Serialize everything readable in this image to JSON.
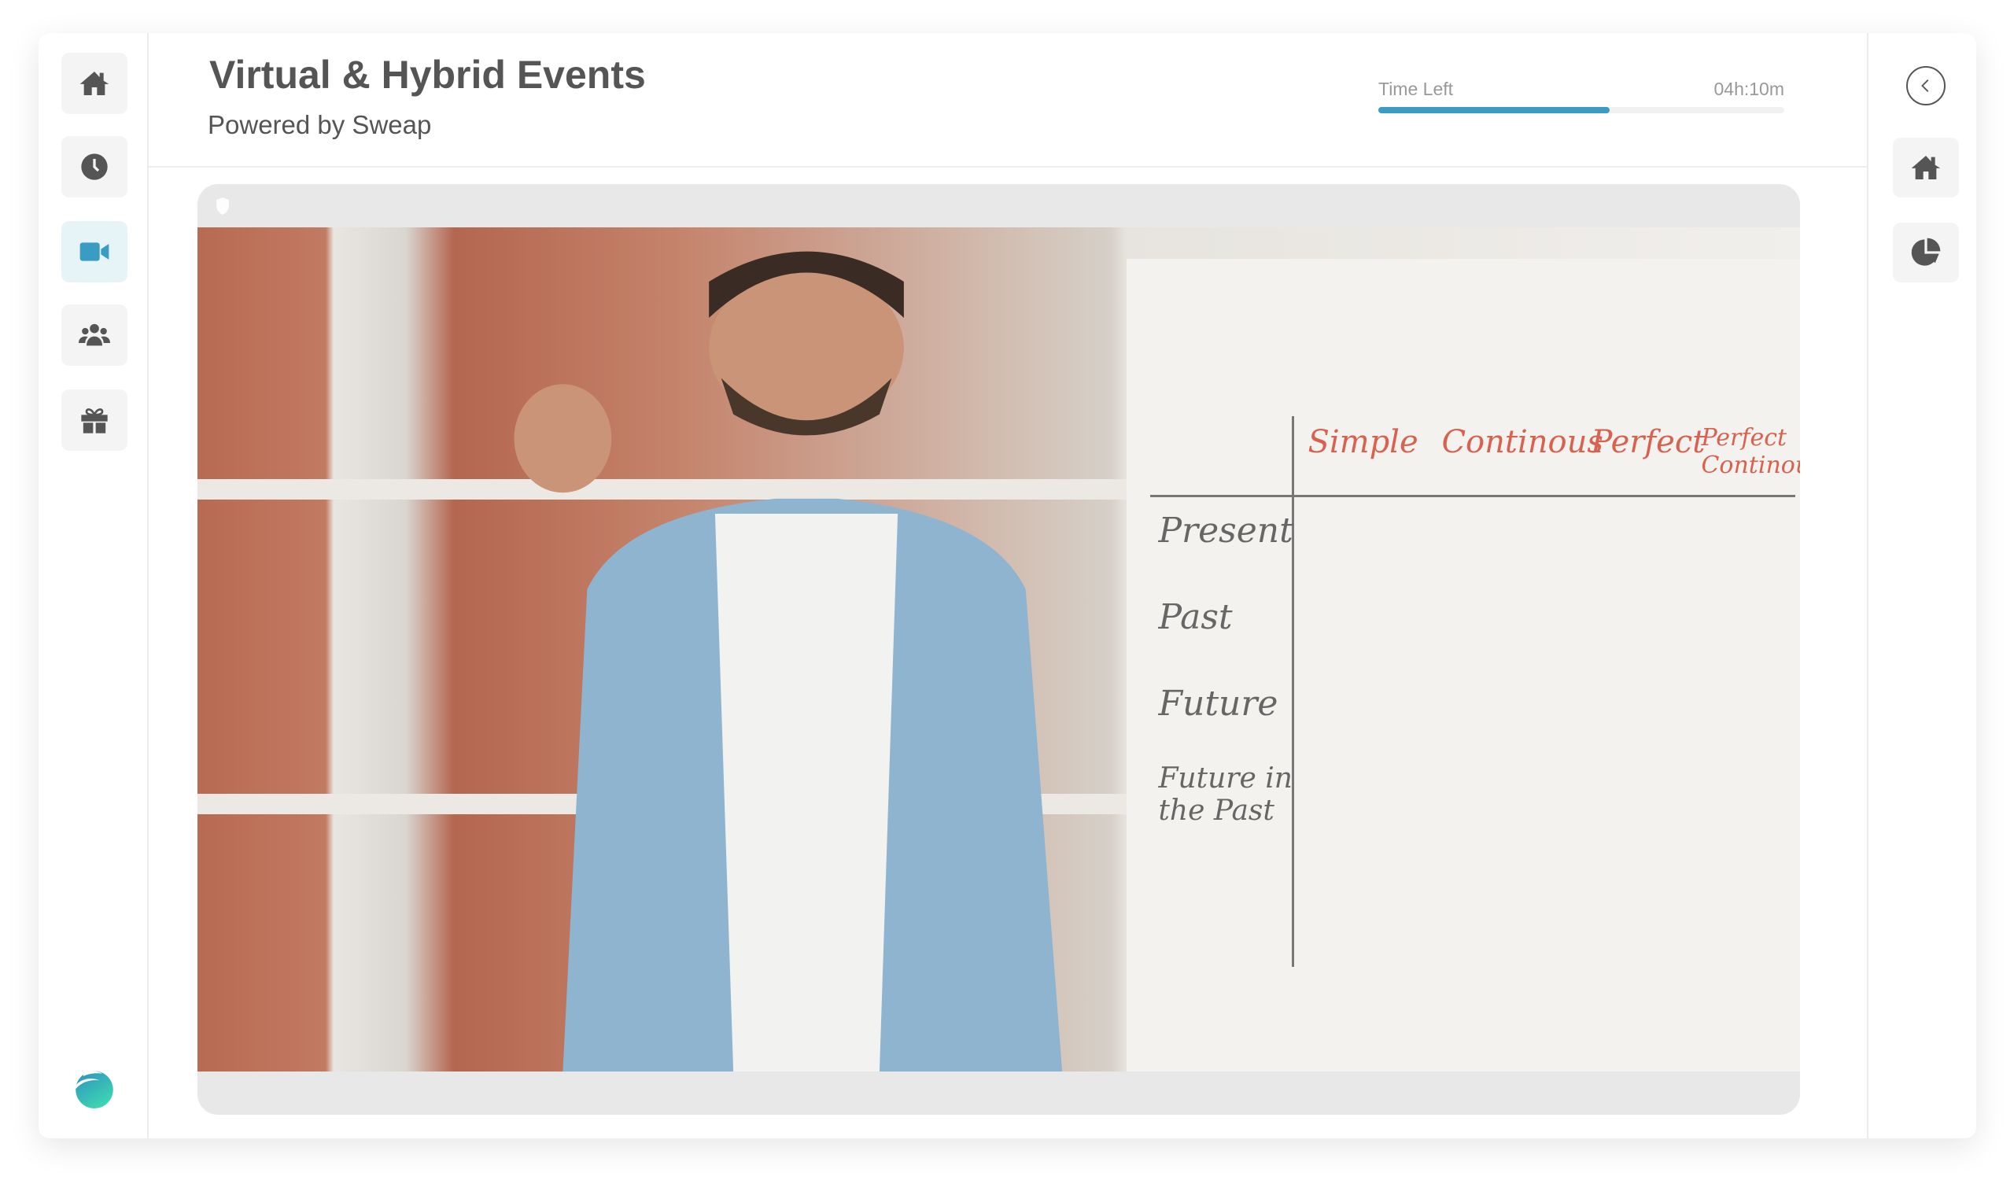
{
  "header": {
    "title": "Virtual & Hybrid Events",
    "subtitle": "Powered by Sweap"
  },
  "timer": {
    "label": "Time Left",
    "value": "04h:10m",
    "progress_fraction": 0.57
  },
  "sidebar": {
    "items": [
      {
        "icon": "home-icon",
        "active": false
      },
      {
        "icon": "clock-icon",
        "active": false
      },
      {
        "icon": "video-camera-icon",
        "active": true
      },
      {
        "icon": "users-icon",
        "active": false
      },
      {
        "icon": "gift-icon",
        "active": false
      }
    ]
  },
  "right_sidebar": {
    "items": [
      {
        "icon": "chevron-left-icon"
      },
      {
        "icon": "home-icon"
      },
      {
        "icon": "pie-chart-icon"
      }
    ]
  },
  "whiteboard": {
    "columns": [
      "Simple",
      "Continous",
      "Perfect",
      "Perfect Continous"
    ],
    "rows": [
      "Present",
      "Past",
      "Future",
      "Future in the Past"
    ]
  },
  "colors": {
    "accent": "#3a9cc4",
    "icon": "#555555",
    "button_bg": "#f4f4f4",
    "active_bg": "#e6f4f8"
  }
}
